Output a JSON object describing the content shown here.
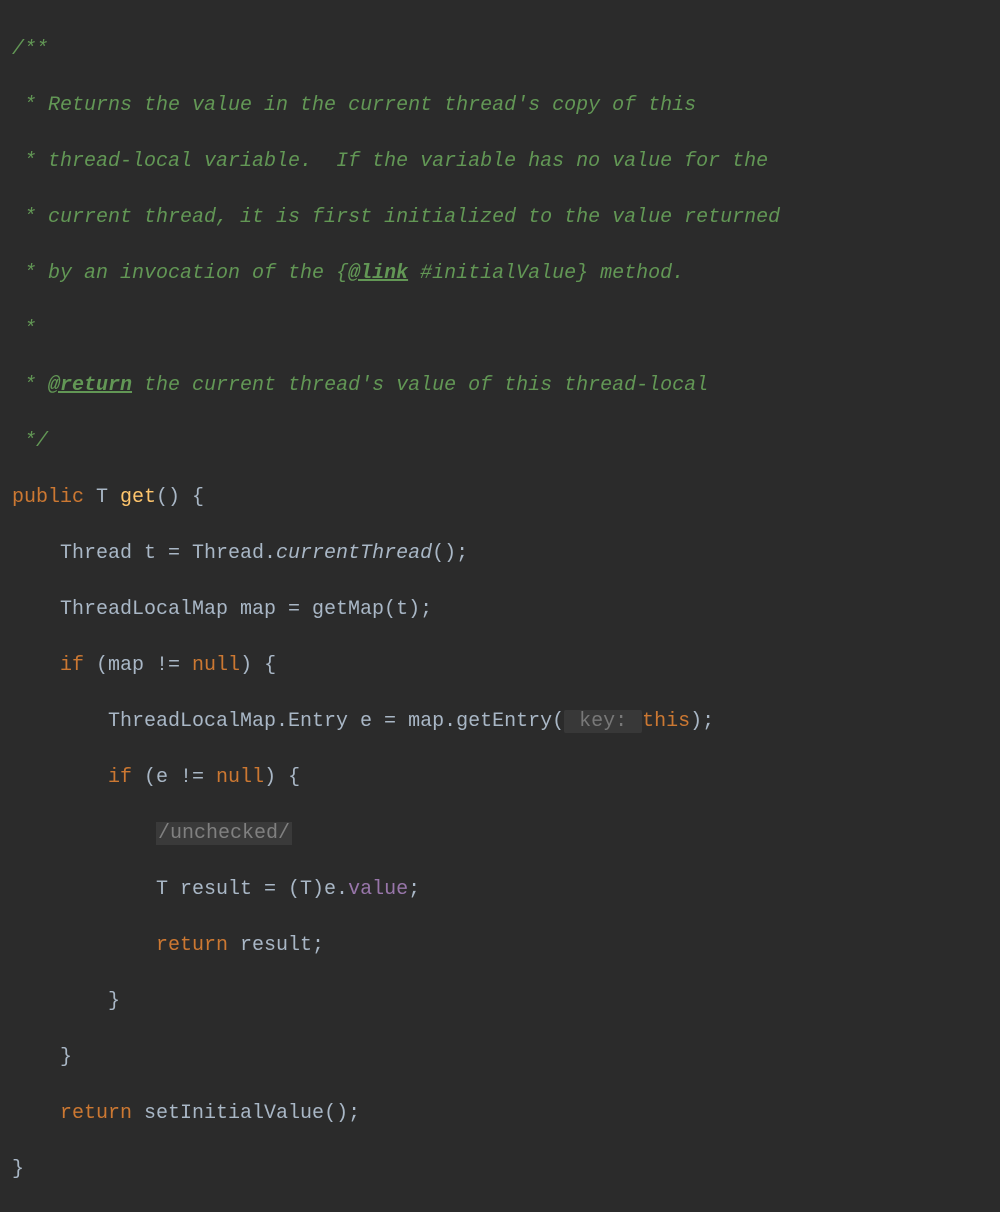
{
  "code": {
    "comment_open": "/**",
    "comment_line1_prefix": " * ",
    "comment_line1": "Returns the value in the current thread's copy of this",
    "comment_line2_prefix": " * ",
    "comment_line2": "thread-local variable.  If the variable has no value for the",
    "comment_line3_prefix": " * ",
    "comment_line3": "current thread, it is first initialized to the value returned",
    "comment_line4_prefix": " * ",
    "comment_line4_a": "by an invocation of the {",
    "comment_line4_tag": "@link",
    "comment_line4_b": " #initialValue} method.",
    "comment_line5": " *",
    "comment_line6_prefix": " * ",
    "comment_line6_tag": "@return",
    "comment_line6_rest": " the current thread's value of this thread-local",
    "comment_close": " */",
    "kw_public": "public",
    "type_T1": " T ",
    "method_get": "get",
    "sig_paren": "() {",
    "l2_a": "    Thread t = Thread.",
    "l2_b": "currentThread",
    "l2_c": "();",
    "l3_a": "    ThreadLocalMap map = getMap(t);",
    "l4_kw_if": "    if",
    "l4_rest_a": " (map != ",
    "kw_null": "null",
    "l4_rest_b": ") {",
    "l5_a": "        ThreadLocalMap.Entry e = map.getEntry(",
    "l5_hint": " key: ",
    "l5_kw_this": "this",
    "l5_b": ");",
    "l6_kw_if": "        if",
    "l6_a": " (e != ",
    "l6_b": ") {",
    "l7_indent": "            ",
    "l7_folded": "/unchecked/",
    "l8_a": "            T result = (T)e.",
    "l8_field": "value",
    "l8_b": ";",
    "l9_kw_return": "            return",
    "l9_rest": " result;",
    "l10": "        }",
    "l11": "    }",
    "l12_kw_return": "    return",
    "l12_rest": " setInitialValue();",
    "l13": "}"
  }
}
